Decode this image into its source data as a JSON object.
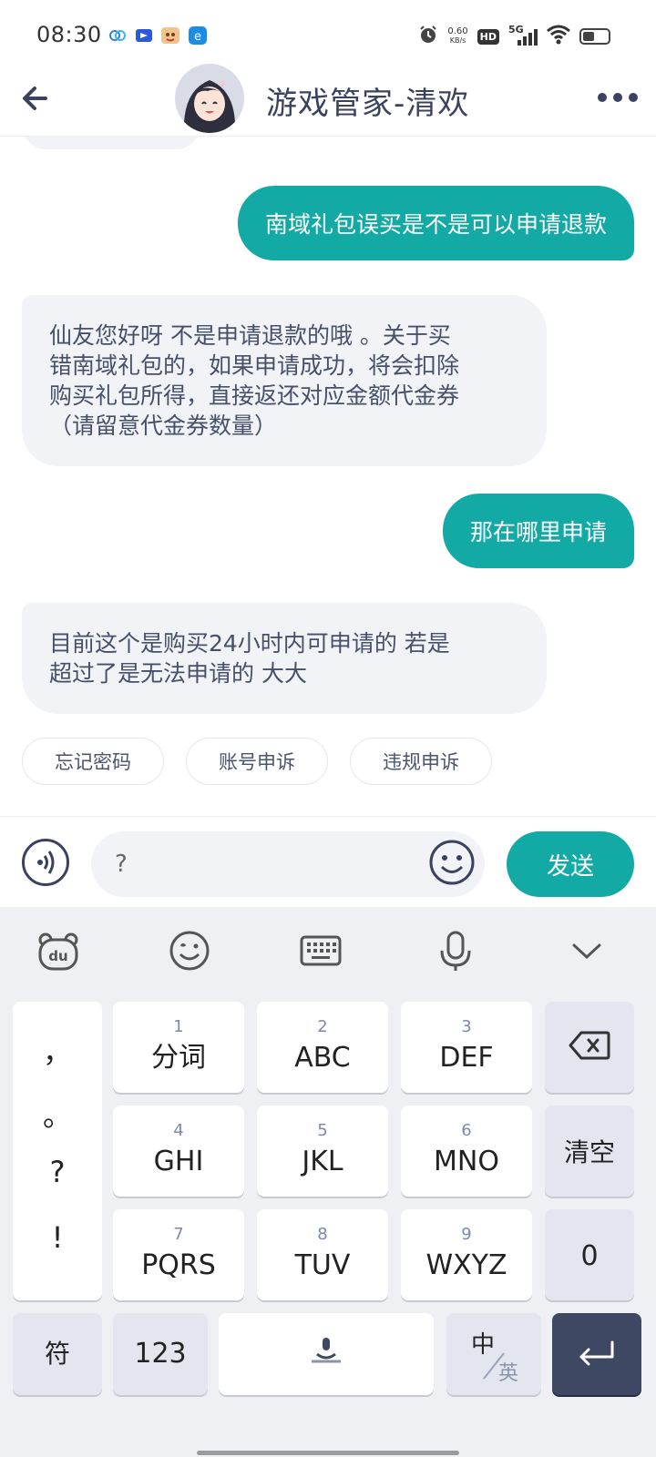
{
  "status_bar": {
    "time": "08:30",
    "net_speed_value": "0.60",
    "net_speed_unit": "KB/s",
    "hd_badge": "HD",
    "network": "5G",
    "battery_level": 0.45
  },
  "header": {
    "title": "游戏管家-清欢",
    "avatar_icon": "anime-girl-avatar",
    "back_icon": "arrow-left-icon",
    "more_icon": "more-dots-icon"
  },
  "messages": [
    {
      "from": "user",
      "text": "南域礼包误买是不是可以申请退款"
    },
    {
      "from": "agent",
      "lines": [
        "仙友您好呀 不是申请退款的哦 。关于买",
        "错南域礼包的，如果申请成功，将会扣除",
        "购买礼包所得，直接返还对应金额代金券",
        "（请留意代金券数量）"
      ]
    },
    {
      "from": "user",
      "text": "那在哪里申请"
    },
    {
      "from": "agent",
      "lines": [
        "目前这个是购买24小时内可申请的 若是",
        "超过了是无法申请的 大大"
      ]
    }
  ],
  "quick_replies": [
    "忘记密码",
    "账号申诉",
    "违规申诉"
  ],
  "input": {
    "value": "?",
    "send_label": "发送"
  },
  "keyboard": {
    "punctuation": [
      "，",
      "。",
      "?",
      "!"
    ],
    "keys": [
      {
        "num": "1",
        "label": "分词"
      },
      {
        "num": "2",
        "label": "ABC"
      },
      {
        "num": "3",
        "label": "DEF"
      },
      {
        "num": "4",
        "label": "GHI"
      },
      {
        "num": "5",
        "label": "JKL"
      },
      {
        "num": "6",
        "label": "MNO"
      },
      {
        "num": "7",
        "label": "PQRS"
      },
      {
        "num": "8",
        "label": "TUV"
      },
      {
        "num": "9",
        "label": "WXYZ"
      }
    ],
    "clear_label": "清空",
    "zero_label": "0",
    "symbol_label": "符",
    "numeric_label": "123",
    "lang_top": "中",
    "lang_bottom": "英"
  },
  "colors": {
    "accent": "#13aaa6",
    "bubble_in": "#f1f3f7",
    "title": "#3a4260",
    "keyboard_bg": "#eff0f3",
    "enter_key": "#3e4862"
  }
}
